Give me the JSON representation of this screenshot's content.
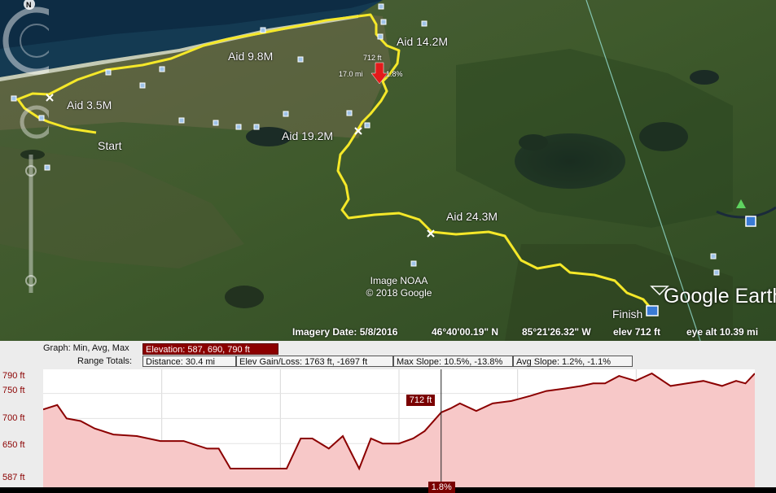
{
  "map": {
    "labels": {
      "start": "Start",
      "finish": "Finish",
      "aid1": "Aid 3.5M",
      "aid2": "Aid 9.8M",
      "aid3": "Aid 14.2M",
      "aid4": "Aid 19.2M",
      "aid5": "Aid 24.3M"
    },
    "cursor": {
      "elevation": "712 ft",
      "distance": "17.0 mi",
      "slope": "1.8%"
    },
    "credit_line1": "Image NOAA",
    "credit_line2": "© 2018 Google",
    "logo": "Google Earth",
    "compass_n": "N"
  },
  "status": {
    "imagery_date": "Imagery Date: 5/8/2016",
    "lat": "46°40'00.19\" N",
    "lon": "85°21'26.32\" W",
    "elev": "elev  712 ft",
    "eye_alt": "eye alt  10.39 mi"
  },
  "graph": {
    "header": {
      "graph_label": "Graph: Min, Avg, Max",
      "elevation": "Elevation: 587, 690, 790 ft",
      "range_label": "Range Totals:",
      "distance": "Distance: 30.4 mi",
      "gain_loss": "Elev Gain/Loss: 1763 ft, -1697 ft",
      "max_slope": "Max Slope: 10.5%, -13.8%",
      "avg_slope": "Avg Slope: 1.2%, -1.1%"
    },
    "yticks": [
      "790 ft",
      "750 ft",
      "700 ft",
      "650 ft",
      "587 ft"
    ],
    "cursor_elev": "712 ft",
    "cursor_slope": "1.8%"
  },
  "colors": {
    "route": "#f5e829",
    "profile_line": "#8b0000",
    "profile_fill": "#f7c8c8",
    "elevation_box": "#8b0000"
  },
  "chart_data": {
    "type": "area",
    "ylim": [
      587,
      790
    ],
    "xlim": [
      0,
      30.4
    ],
    "x": [
      0,
      0.6,
      1.0,
      1.6,
      2.2,
      3.0,
      4.0,
      5.0,
      6.0,
      7.0,
      7.5,
      8.0,
      8.9,
      9.6,
      10.4,
      11.0,
      11.5,
      12.2,
      12.8,
      13.5,
      14.0,
      14.5,
      15.2,
      15.8,
      16.3,
      17.0,
      17.4,
      17.8,
      18.5,
      19.2,
      20.0,
      20.8,
      21.5,
      22.3,
      23.0,
      23.5,
      24.0,
      24.6,
      25.3,
      26.0,
      26.8,
      27.5,
      28.2,
      29.0,
      29.6,
      30.0,
      30.4
    ],
    "elevation_ft": [
      718,
      727,
      700,
      695,
      680,
      668,
      665,
      655,
      655,
      640,
      640,
      600,
      600,
      600,
      600,
      660,
      660,
      640,
      665,
      600,
      660,
      650,
      650,
      660,
      675,
      712,
      720,
      730,
      715,
      730,
      735,
      745,
      755,
      760,
      765,
      770,
      770,
      785,
      775,
      790,
      765,
      770,
      775,
      765,
      775,
      770,
      790
    ]
  }
}
